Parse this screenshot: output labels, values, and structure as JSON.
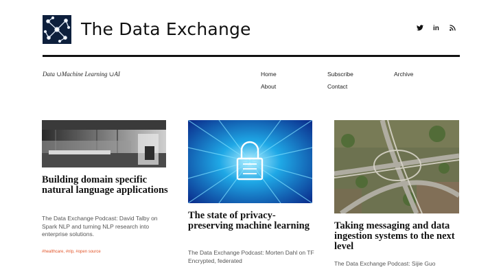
{
  "site": {
    "title": "The Data Exchange",
    "tagline": "Data ∪Machine Learning ∪AI"
  },
  "social": {
    "twitter": "☀",
    "linkedin": "in",
    "rss": " "
  },
  "social_icons": [
    "twitter-icon",
    "linkedin-icon",
    "rss-icon"
  ],
  "nav": {
    "home": "Home",
    "subscribe": "Subscribe",
    "archive": "Archive",
    "about": "About",
    "contact": "Contact"
  },
  "cards": [
    {
      "title": "Building domain specific natural language applications",
      "description": "The Data Exchange Podcast: David Talby on Spark NLP and turning NLP research into enterprise solutions.",
      "tags": "#healthcare, #nlp, #open source"
    },
    {
      "title": "The state of privacy-preserving machine learning",
      "description": "The Data Exchange Podcast: Morten Dahl on TF Encrypted, federated"
    },
    {
      "title": "Taking messaging and data ingestion systems to the next level",
      "description": "The Data Exchange Podcast: Sijie Guo"
    }
  ],
  "colors": {
    "tag": "#e2552a",
    "logo_bg": "#0d1f3c",
    "rule": "#111111"
  }
}
